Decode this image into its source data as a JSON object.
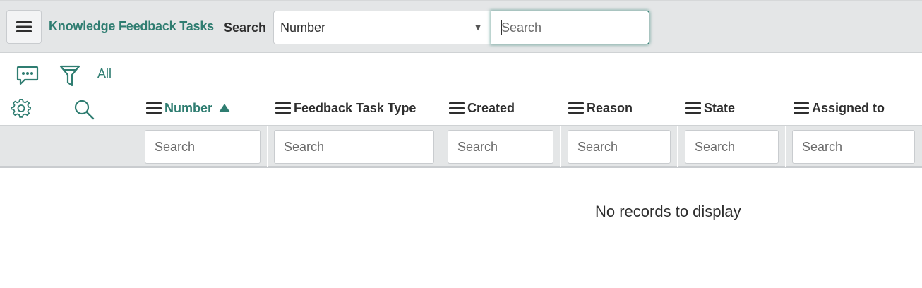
{
  "header": {
    "title": "Knowledge Feedback Tasks",
    "search_label": "Search",
    "field_select": {
      "selected": "Number"
    },
    "search_input": {
      "placeholder": "Search",
      "value": ""
    }
  },
  "toolbar": {
    "breadcrumb": "All",
    "icons": [
      "chat-bubble-icon",
      "filter-funnel-icon",
      "gear-icon",
      "search-icon"
    ]
  },
  "table": {
    "columns": [
      {
        "label": "Number",
        "sorted": "ascending"
      },
      {
        "label": "Feedback Task Type"
      },
      {
        "label": "Created"
      },
      {
        "label": "Reason"
      },
      {
        "label": "State"
      },
      {
        "label": "Assigned to"
      }
    ],
    "filter_placeholder": "Search",
    "empty_message": "No records to display"
  },
  "colors": {
    "accent": "#2f7d71",
    "header_bg": "#e4e6e7",
    "text": "#2e2e2e"
  }
}
